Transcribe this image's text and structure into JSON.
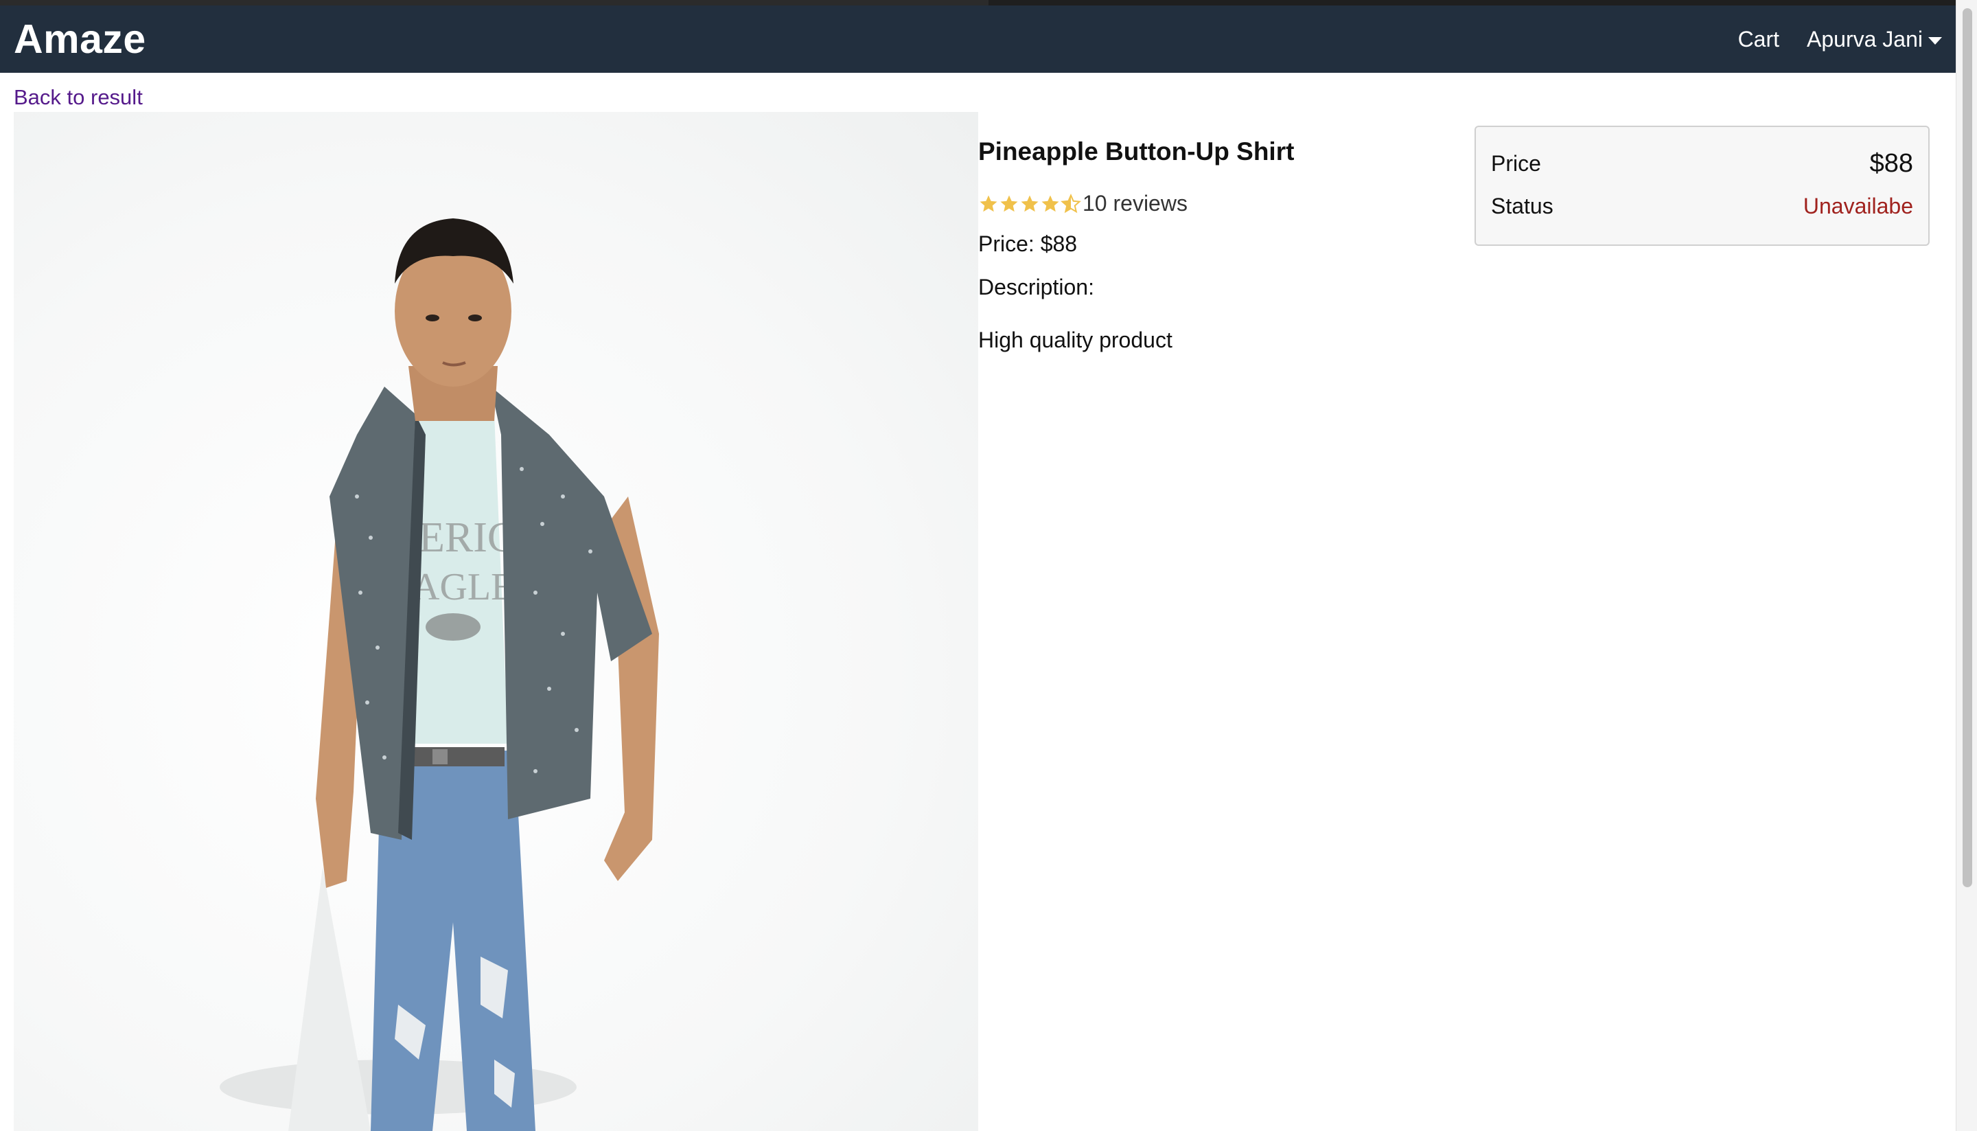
{
  "navbar": {
    "brand": "Amaze",
    "cart_label": "Cart",
    "user_name": "Apurva Jani"
  },
  "back_link": "Back to result",
  "product": {
    "name": "Pineapple Button-Up Shirt",
    "rating": 4.5,
    "rating_max": 5,
    "reviews_text": "10 reviews",
    "price_line": "Price: $88",
    "description_label": "Description:",
    "description": "High quality product",
    "image_icon": "product-photo-shirt-model"
  },
  "price_card": {
    "price_label": "Price",
    "price_value": "$88",
    "status_label": "Status",
    "status_value": "Unavailabe"
  },
  "colors": {
    "navbar_bg": "#222f3e",
    "link": "#551a8b",
    "star": "#f0c14b",
    "status_unavailable": "#a0221e"
  }
}
